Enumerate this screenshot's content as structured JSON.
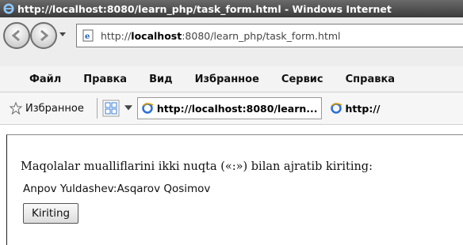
{
  "window": {
    "title": "http://localhost:8080/learn_php/task_form.html - Windows Internet"
  },
  "address_bar": {
    "url_prefix": "http://",
    "url_host": "localhost",
    "url_rest": ":8080/learn_php/task_form.html"
  },
  "menu": {
    "items": [
      "Файл",
      "Правка",
      "Вид",
      "Избранное",
      "Сервис",
      "Справка"
    ]
  },
  "favorites_bar": {
    "favorites_label": "Избранное",
    "tabs": [
      {
        "label": "http://localhost:8080/learn...",
        "icon": "ie-page-icon"
      },
      {
        "label": "http://",
        "icon": "ie-page-icon"
      }
    ]
  },
  "page": {
    "instruction": "Maqolalar mualliflarini ikki nuqta («:») bilan ajratib kiriting:",
    "input_value": "Anpov Yuldashev:Asqarov Qosimov",
    "submit_label": "Kiriting"
  },
  "colors": {
    "titlebar": "#3b3b3b",
    "chrome": "#ededed"
  }
}
